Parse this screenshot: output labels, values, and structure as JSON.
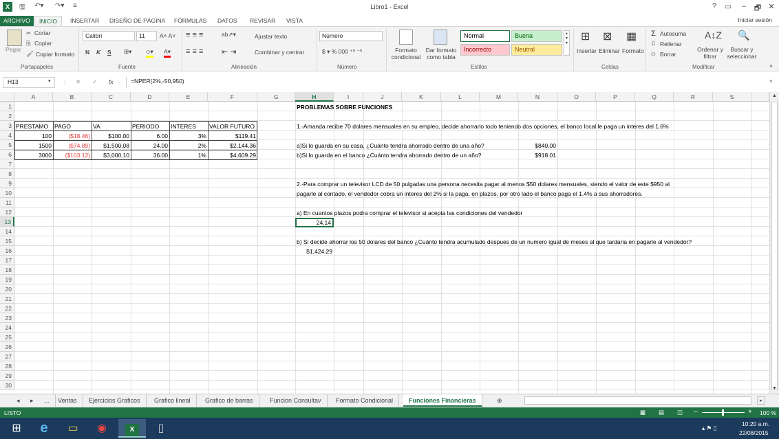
{
  "window": {
    "title": "Libro1 - Excel",
    "signin": "Iniciar sesión",
    "controls": [
      "?",
      "▭",
      "–",
      "🗗",
      "✕"
    ]
  },
  "quick_access": {
    "save_icon": "save-icon",
    "undo_icon": "undo-icon",
    "redo_icon": "redo-icon"
  },
  "ribbon_tabs": [
    "ARCHIVO",
    "INICIO",
    "INSERTAR",
    "DISEÑO DE PÁGINA",
    "FÓRMULAS",
    "DATOS",
    "REVISAR",
    "VISTA"
  ],
  "ribbon": {
    "clipboard": {
      "paste": "Pegar",
      "cut": "Cortar",
      "copy": "Copiar",
      "format_painter": "Copiar formato",
      "group": "Portapapeles"
    },
    "font": {
      "name": "Calibri",
      "size": "11",
      "bold": "N",
      "italic": "K",
      "underline": "S",
      "group": "Fuente"
    },
    "alignment": {
      "wrap": "Ajustar texto",
      "merge": "Combinar y centrar",
      "group": "Alineación"
    },
    "number": {
      "format": "Número",
      "group": "Número"
    },
    "styles": {
      "cond": "Formato condicional",
      "table": "Dar formato como tabla",
      "normal": "Normal",
      "buena": "Buena",
      "incorrecto": "Incorrecto",
      "neutral": "Neutral",
      "group": "Estilos"
    },
    "cells": {
      "insert": "Insertar",
      "delete": "Eliminar",
      "format": "Formato",
      "group": "Celdas"
    },
    "editing": {
      "autosum": "Autosuma",
      "fill": "Rellenar",
      "clear": "Borrar",
      "sort": "Ordenar y filtrar",
      "find": "Buscar y seleccionar",
      "group": "Modificar"
    }
  },
  "formula_bar": {
    "name_box": "H13",
    "fx": "fx",
    "formula": "=NPER(2%,-50,950)"
  },
  "columns": [
    "A",
    "B",
    "C",
    "D",
    "E",
    "F",
    "G",
    "H",
    "I",
    "J",
    "K",
    "L",
    "M",
    "N",
    "O",
    "P",
    "Q",
    "R",
    "S"
  ],
  "rows": [
    "1",
    "2",
    "3",
    "4",
    "5",
    "6",
    "7",
    "8",
    "9",
    "10",
    "11",
    "12",
    "13",
    "14",
    "15",
    "16",
    "17",
    "18",
    "19",
    "20",
    "21",
    "22",
    "23",
    "24",
    "25",
    "26",
    "27",
    "28",
    "29",
    "30"
  ],
  "table": {
    "headers": [
      "PRESTAMO",
      "PAGO",
      "VA",
      "PERIODO",
      "INTERES",
      "VALOR FUTURO"
    ],
    "rows": [
      [
        "100",
        "($18.46)",
        "$100.00",
        "6.00",
        "3%",
        "$119.41"
      ],
      [
        "1500",
        "($74.89)",
        "$1,500.08",
        "24.00",
        "2%",
        "$2,144.36"
      ],
      [
        "3000",
        "($103.12)",
        "$3,000.10",
        "36.00",
        "1%",
        "$4,609.29"
      ]
    ]
  },
  "content": {
    "title": "PROBLEMAS SOBRE FUNCIONES",
    "p1": "1.-Amanda recibe 70 dolares mensuales en su empleo, decide ahorrarlo todo teniendo dos opciones, el banco local le paga un interes del 1.6%",
    "q1a": "a)Si lo guarda en su casa, ¿Cuánto tendra ahorrado dentro de una año?",
    "a1a": "$840.00",
    "q1b": "b)Si lo guarda en el banco ¿Cuánto tendra ahorrado dentro de un año?",
    "a1b": "$918.01",
    "p2a": "2.-Para comprar un televisor LCD de 50 pulgadas una persona necesita pagar al menos $50 dolares mensuales, siendo el valor de este $950 al",
    "p2b": "pagarle al contado, el vendedor cobra un interes del 2% si la paga, en plazos, por otro lado el banco paga el 1.4% a sus ahorradores.",
    "q2a": "a) En cuantos plazos podra comprar el televisor si acepta las condiciones del vendedor",
    "a2a": "24.14",
    "q2b": "b) Si decide ahorrar los 50 dolares del banco ¿Cuánto tendra acumulado despues de un numero igual de meses al que tardaria en pagarle al vendedor?",
    "a2b": "$1,424.29"
  },
  "sheet_tabs": [
    "...",
    "Ventas",
    "Ejercicios Graficos",
    "Grafico lineal",
    "Grafico de barras",
    "Funcion Consultav",
    "Formato Condicional",
    "Funciones Financieras"
  ],
  "status": {
    "mode": "LISTO",
    "zoom": "100 %"
  },
  "taskbar": {
    "time": "10:20 a.m.",
    "date": "22/08/2015"
  }
}
